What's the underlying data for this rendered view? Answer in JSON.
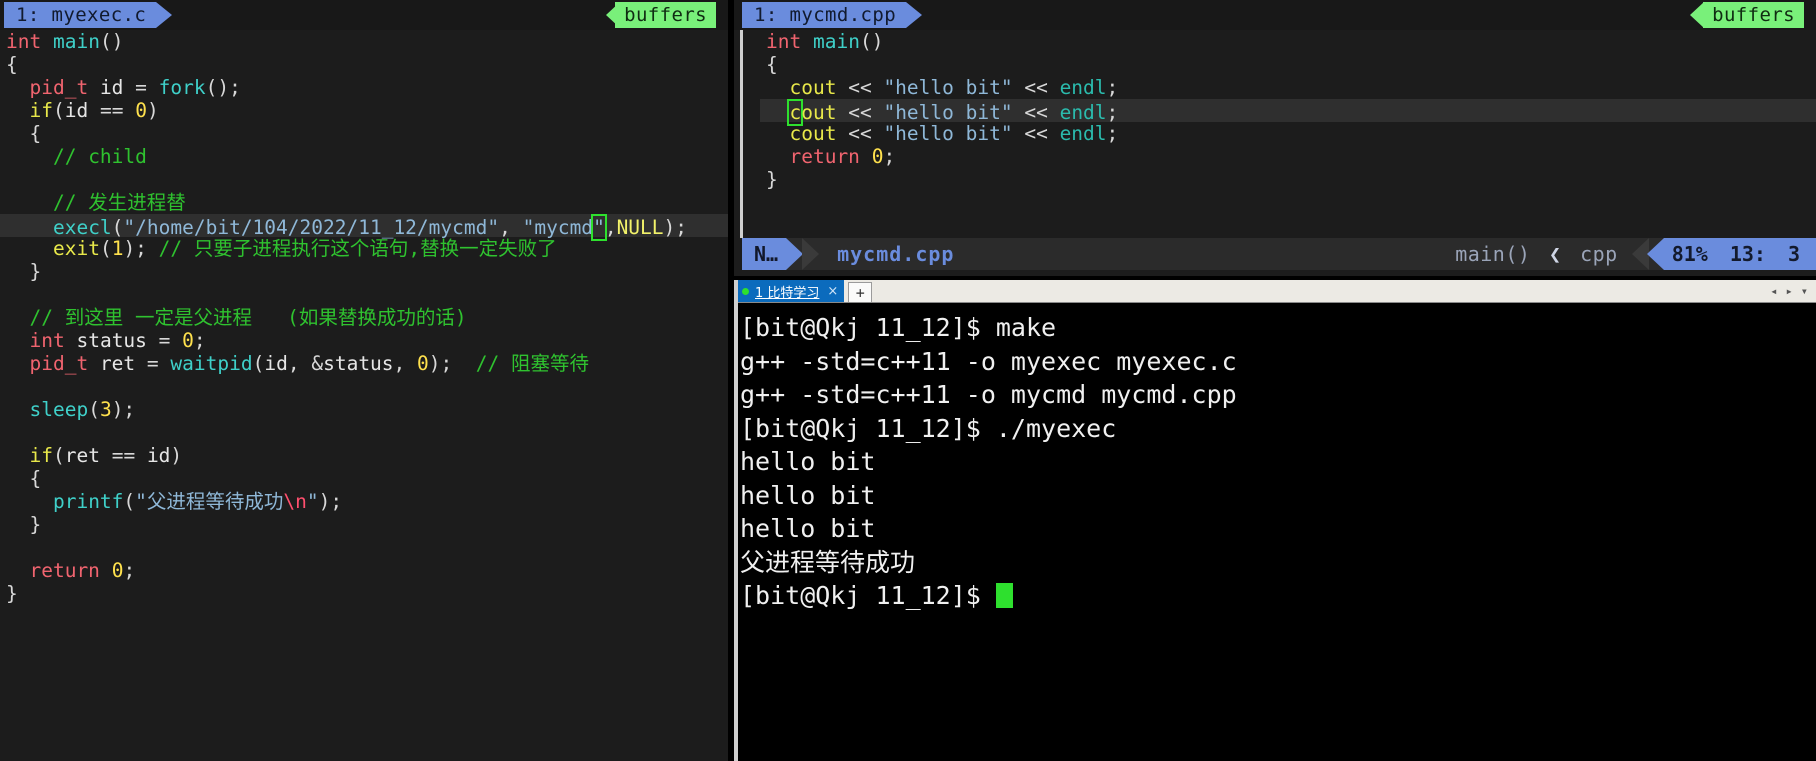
{
  "left_editor": {
    "tab": {
      "label": "1: myexec.c"
    },
    "buffers_label": "buffers",
    "lines": [
      {
        "id": "l1",
        "text": "int main()"
      },
      {
        "id": "l2",
        "text": "{"
      },
      {
        "id": "l3",
        "text": "  pid_t id = fork();"
      },
      {
        "id": "l4",
        "text": "  if(id == 0)"
      },
      {
        "id": "l5",
        "text": "  {"
      },
      {
        "id": "l6",
        "text": "    // child"
      },
      {
        "id": "l7",
        "text": ""
      },
      {
        "id": "l8",
        "text": "    // 发生进程替"
      },
      {
        "id": "l9",
        "text": "    execl(\"/home/bit/104/2022/11_12/mycmd\", \"mycmd\",NULL);",
        "highlighted": true
      },
      {
        "id": "l10",
        "text": "    exit(1); // 只要子进程执行这个语句,替换一定失败了"
      },
      {
        "id": "l11",
        "text": "  }"
      },
      {
        "id": "l12",
        "text": ""
      },
      {
        "id": "l13",
        "text": "  // 到这里 一定是父进程   (如果替换成功的话)"
      },
      {
        "id": "l14",
        "text": "  int status = 0;"
      },
      {
        "id": "l15",
        "text": "  pid_t ret = waitpid(id, &status, 0);  // 阻塞等待"
      },
      {
        "id": "l16",
        "text": ""
      },
      {
        "id": "l17",
        "text": "  sleep(3);"
      },
      {
        "id": "l18",
        "text": ""
      },
      {
        "id": "l19",
        "text": "  if(ret == id)"
      },
      {
        "id": "l20",
        "text": "  {"
      },
      {
        "id": "l21",
        "text": "    printf(\"父进程等待成功\\n\");"
      },
      {
        "id": "l22",
        "text": "  }"
      },
      {
        "id": "l23",
        "text": ""
      },
      {
        "id": "l24",
        "text": "  return 0;"
      },
      {
        "id": "l25",
        "text": "}"
      }
    ]
  },
  "right_editor": {
    "tab": {
      "label": "1: mycmd.cpp"
    },
    "buffers_label": "buffers",
    "lines": [
      {
        "id": "r1",
        "text": "int main()"
      },
      {
        "id": "r2",
        "text": "{"
      },
      {
        "id": "r3",
        "text": "  cout << \"hello bit\" << endl;"
      },
      {
        "id": "r4",
        "text": "  cout << \"hello bit\" << endl;",
        "highlighted": true
      },
      {
        "id": "r5",
        "text": "  cout << \"hello bit\" << endl;"
      },
      {
        "id": "r6",
        "text": "  return 0;"
      },
      {
        "id": "r7",
        "text": "}"
      }
    ],
    "statusline": {
      "mode": "N…",
      "filename": "mycmd.cpp",
      "context": "main()",
      "chevron": "❮",
      "filetype": "cpp",
      "percent": "81%",
      "line": "13:",
      "col": "3"
    }
  },
  "terminal": {
    "tab": {
      "label": "1 比特学习",
      "close_glyph": "×",
      "status_color": "#2ee02e"
    },
    "new_tab_label": "+",
    "scroll_left_glyph": "◂",
    "scroll_right_glyph": "▸",
    "menu_glyph": "▾",
    "lines": [
      "[bit@Qkj 11_12]$ make",
      "g++ -std=c++11 -o myexec myexec.c",
      "g++ -std=c++11 -o mycmd mycmd.cpp",
      "[bit@Qkj 11_12]$ ./myexec",
      "hello bit",
      "hello bit",
      "hello bit",
      "父进程等待成功"
    ],
    "prompt": "[bit@Qkj 11_12]$ "
  },
  "colors": {
    "accent_blue": "#6a8cdd",
    "buffers_green": "#79f07a",
    "cursor_green": "#2ee02e",
    "terminal_tab_blue": "#0b6bbd",
    "editor_bg": "#1c1c1c",
    "terminal_bg": "#000000"
  }
}
